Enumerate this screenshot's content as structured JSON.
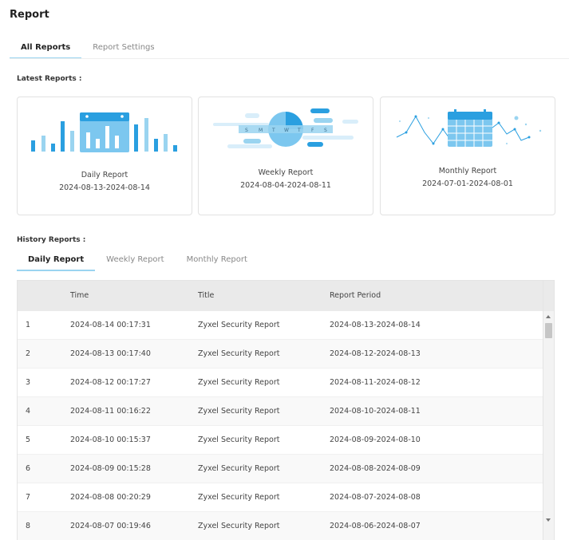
{
  "page": {
    "title": "Report"
  },
  "top_tabs": [
    {
      "label": "All Reports",
      "active": true
    },
    {
      "label": "Report Settings",
      "active": false
    }
  ],
  "latest": {
    "label": "Latest Reports :",
    "cards": [
      {
        "title": "Daily Report",
        "period": "2024-08-13-2024-08-14",
        "icon": "daily-report-illustration"
      },
      {
        "title": "Weekly Report",
        "period": "2024-08-04-2024-08-11",
        "icon": "weekly-report-illustration",
        "day_letters": [
          "S",
          "M",
          "T",
          "W",
          "T",
          "F",
          "S"
        ]
      },
      {
        "title": "Monthly Report",
        "period": "2024-07-01-2024-08-01",
        "icon": "monthly-report-illustration"
      }
    ]
  },
  "history": {
    "label": "History Reports :",
    "tabs": [
      {
        "label": "Daily Report",
        "active": true
      },
      {
        "label": "Weekly Report",
        "active": false
      },
      {
        "label": "Monthly Report",
        "active": false
      }
    ],
    "columns": {
      "num": "",
      "time": "Time",
      "title": "Title",
      "period": "Report Period"
    },
    "rows": [
      {
        "num": "1",
        "time": "2024-08-14 00:17:31",
        "title": "Zyxel Security Report",
        "period": "2024-08-13-2024-08-14"
      },
      {
        "num": "2",
        "time": "2024-08-13 00:17:40",
        "title": "Zyxel Security Report",
        "period": "2024-08-12-2024-08-13"
      },
      {
        "num": "3",
        "time": "2024-08-12 00:17:27",
        "title": "Zyxel Security Report",
        "period": "2024-08-11-2024-08-12"
      },
      {
        "num": "4",
        "time": "2024-08-11 00:16:22",
        "title": "Zyxel Security Report",
        "period": "2024-08-10-2024-08-11"
      },
      {
        "num": "5",
        "time": "2024-08-10 00:15:37",
        "title": "Zyxel Security Report",
        "period": "2024-08-09-2024-08-10"
      },
      {
        "num": "6",
        "time": "2024-08-09 00:15:28",
        "title": "Zyxel Security Report",
        "period": "2024-08-08-2024-08-09"
      },
      {
        "num": "7",
        "time": "2024-08-08 00:20:29",
        "title": "Zyxel Security Report",
        "period": "2024-08-07-2024-08-08"
      },
      {
        "num": "8",
        "time": "2024-08-07 00:19:46",
        "title": "Zyxel Security Report",
        "period": "2024-08-06-2024-08-07"
      }
    ]
  },
  "colors": {
    "accent": "#2a9fe0",
    "accent_light": "#9ad4f0",
    "header_bg": "#eaeaea"
  }
}
